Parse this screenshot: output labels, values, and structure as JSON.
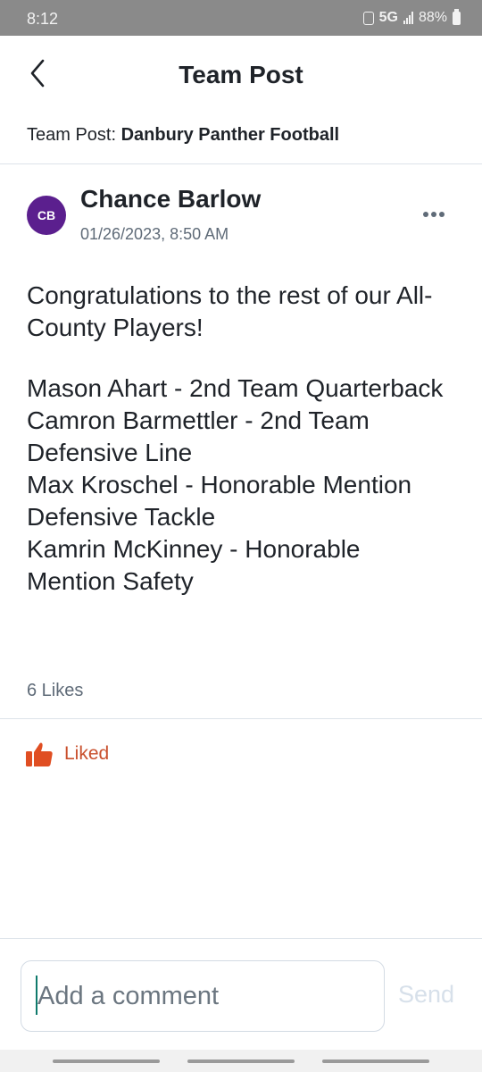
{
  "status_bar": {
    "time": "8:12",
    "network": "5G",
    "battery": "88%"
  },
  "header": {
    "title": "Team Post",
    "back_icon": "chevron-left-icon"
  },
  "team": {
    "prefix": "Team Post: ",
    "name": "Danbury Panther Football"
  },
  "post": {
    "author_initials": "CB",
    "author_name": "Chance Barlow",
    "date": "01/26/2023, 8:50 AM",
    "avatar_color": "#5b1f8e",
    "intro": "Congratulations to the rest of our All-County Players!",
    "lines": [
      "Mason Ahart - 2nd Team Quarterback",
      "Camron Barmettler - 2nd Team Defensive Line",
      "Max Kroschel - Honorable Mention Defensive Tackle",
      "Kamrin McKinney - Honorable Mention Safety"
    ]
  },
  "reactions": {
    "likes_text": "6 Likes",
    "liked_label": "Liked",
    "liked_color": "#c9502d"
  },
  "comment": {
    "placeholder": "Add a comment",
    "send_label": "Send"
  }
}
